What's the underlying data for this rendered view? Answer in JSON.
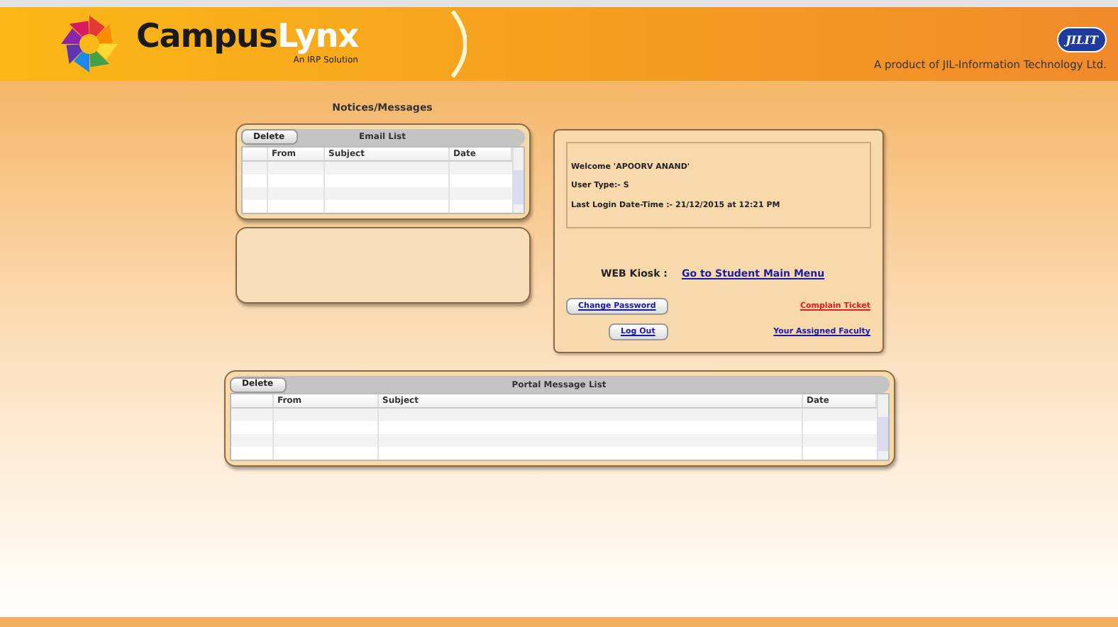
{
  "header": {
    "brand_first": "Campus",
    "brand_second": "Lynx",
    "tagline": "An IRP Solution",
    "partner_badge": "JILIT",
    "product_line": "A product of JIL-Information Technology Ltd."
  },
  "notices_title": "Notices/Messages",
  "email_list": {
    "delete_button": "Delete",
    "title": "Email List",
    "columns": [
      "From",
      "Subject",
      "Date"
    ]
  },
  "user_panel": {
    "welcome": "Welcome 'APOORV ANAND'",
    "user_type": "User Type:- S",
    "last_login": "Last Login Date-Time :- 21/12/2015 at 12:21 PM",
    "kiosk_label": "WEB Kiosk :",
    "kiosk_link": "Go to Student Main Menu",
    "actions": [
      {
        "kind": "button",
        "label": "Change Password"
      },
      {
        "kind": "link",
        "label": "Complain Ticket",
        "color": "#e02020"
      },
      {
        "kind": "button",
        "label": "Log Out"
      },
      {
        "kind": "link",
        "label": "Your Assigned Faculty",
        "color": "#1a1aa8"
      }
    ]
  },
  "portal_list": {
    "delete_button": "Delete",
    "title": "Portal Message List",
    "columns": [
      "From",
      "Subject",
      "Date"
    ]
  }
}
